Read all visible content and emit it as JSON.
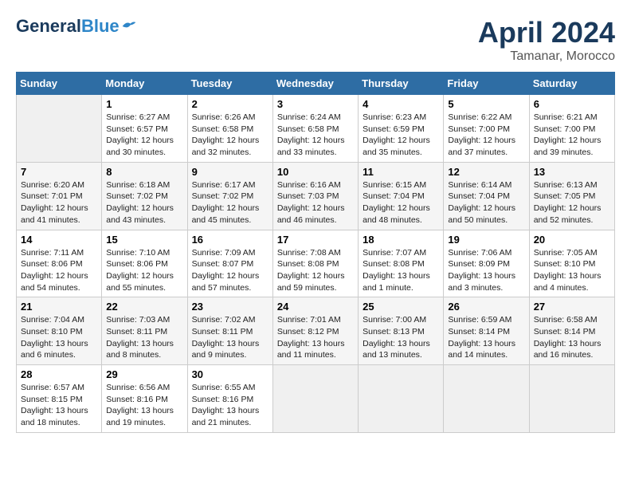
{
  "header": {
    "logo_general": "General",
    "logo_blue": "Blue",
    "month": "April 2024",
    "location": "Tamanar, Morocco"
  },
  "days_of_week": [
    "Sunday",
    "Monday",
    "Tuesday",
    "Wednesday",
    "Thursday",
    "Friday",
    "Saturday"
  ],
  "weeks": [
    [
      {
        "day": "",
        "info": ""
      },
      {
        "day": "1",
        "info": "Sunrise: 6:27 AM\nSunset: 6:57 PM\nDaylight: 12 hours\nand 30 minutes."
      },
      {
        "day": "2",
        "info": "Sunrise: 6:26 AM\nSunset: 6:58 PM\nDaylight: 12 hours\nand 32 minutes."
      },
      {
        "day": "3",
        "info": "Sunrise: 6:24 AM\nSunset: 6:58 PM\nDaylight: 12 hours\nand 33 minutes."
      },
      {
        "day": "4",
        "info": "Sunrise: 6:23 AM\nSunset: 6:59 PM\nDaylight: 12 hours\nand 35 minutes."
      },
      {
        "day": "5",
        "info": "Sunrise: 6:22 AM\nSunset: 7:00 PM\nDaylight: 12 hours\nand 37 minutes."
      },
      {
        "day": "6",
        "info": "Sunrise: 6:21 AM\nSunset: 7:00 PM\nDaylight: 12 hours\nand 39 minutes."
      }
    ],
    [
      {
        "day": "7",
        "info": "Sunrise: 6:20 AM\nSunset: 7:01 PM\nDaylight: 12 hours\nand 41 minutes."
      },
      {
        "day": "8",
        "info": "Sunrise: 6:18 AM\nSunset: 7:02 PM\nDaylight: 12 hours\nand 43 minutes."
      },
      {
        "day": "9",
        "info": "Sunrise: 6:17 AM\nSunset: 7:02 PM\nDaylight: 12 hours\nand 45 minutes."
      },
      {
        "day": "10",
        "info": "Sunrise: 6:16 AM\nSunset: 7:03 PM\nDaylight: 12 hours\nand 46 minutes."
      },
      {
        "day": "11",
        "info": "Sunrise: 6:15 AM\nSunset: 7:04 PM\nDaylight: 12 hours\nand 48 minutes."
      },
      {
        "day": "12",
        "info": "Sunrise: 6:14 AM\nSunset: 7:04 PM\nDaylight: 12 hours\nand 50 minutes."
      },
      {
        "day": "13",
        "info": "Sunrise: 6:13 AM\nSunset: 7:05 PM\nDaylight: 12 hours\nand 52 minutes."
      }
    ],
    [
      {
        "day": "14",
        "info": "Sunrise: 7:11 AM\nSunset: 8:06 PM\nDaylight: 12 hours\nand 54 minutes."
      },
      {
        "day": "15",
        "info": "Sunrise: 7:10 AM\nSunset: 8:06 PM\nDaylight: 12 hours\nand 55 minutes."
      },
      {
        "day": "16",
        "info": "Sunrise: 7:09 AM\nSunset: 8:07 PM\nDaylight: 12 hours\nand 57 minutes."
      },
      {
        "day": "17",
        "info": "Sunrise: 7:08 AM\nSunset: 8:08 PM\nDaylight: 12 hours\nand 59 minutes."
      },
      {
        "day": "18",
        "info": "Sunrise: 7:07 AM\nSunset: 8:08 PM\nDaylight: 13 hours\nand 1 minute."
      },
      {
        "day": "19",
        "info": "Sunrise: 7:06 AM\nSunset: 8:09 PM\nDaylight: 13 hours\nand 3 minutes."
      },
      {
        "day": "20",
        "info": "Sunrise: 7:05 AM\nSunset: 8:10 PM\nDaylight: 13 hours\nand 4 minutes."
      }
    ],
    [
      {
        "day": "21",
        "info": "Sunrise: 7:04 AM\nSunset: 8:10 PM\nDaylight: 13 hours\nand 6 minutes."
      },
      {
        "day": "22",
        "info": "Sunrise: 7:03 AM\nSunset: 8:11 PM\nDaylight: 13 hours\nand 8 minutes."
      },
      {
        "day": "23",
        "info": "Sunrise: 7:02 AM\nSunset: 8:11 PM\nDaylight: 13 hours\nand 9 minutes."
      },
      {
        "day": "24",
        "info": "Sunrise: 7:01 AM\nSunset: 8:12 PM\nDaylight: 13 hours\nand 11 minutes."
      },
      {
        "day": "25",
        "info": "Sunrise: 7:00 AM\nSunset: 8:13 PM\nDaylight: 13 hours\nand 13 minutes."
      },
      {
        "day": "26",
        "info": "Sunrise: 6:59 AM\nSunset: 8:14 PM\nDaylight: 13 hours\nand 14 minutes."
      },
      {
        "day": "27",
        "info": "Sunrise: 6:58 AM\nSunset: 8:14 PM\nDaylight: 13 hours\nand 16 minutes."
      }
    ],
    [
      {
        "day": "28",
        "info": "Sunrise: 6:57 AM\nSunset: 8:15 PM\nDaylight: 13 hours\nand 18 minutes."
      },
      {
        "day": "29",
        "info": "Sunrise: 6:56 AM\nSunset: 8:16 PM\nDaylight: 13 hours\nand 19 minutes."
      },
      {
        "day": "30",
        "info": "Sunrise: 6:55 AM\nSunset: 8:16 PM\nDaylight: 13 hours\nand 21 minutes."
      },
      {
        "day": "",
        "info": ""
      },
      {
        "day": "",
        "info": ""
      },
      {
        "day": "",
        "info": ""
      },
      {
        "day": "",
        "info": ""
      }
    ]
  ]
}
